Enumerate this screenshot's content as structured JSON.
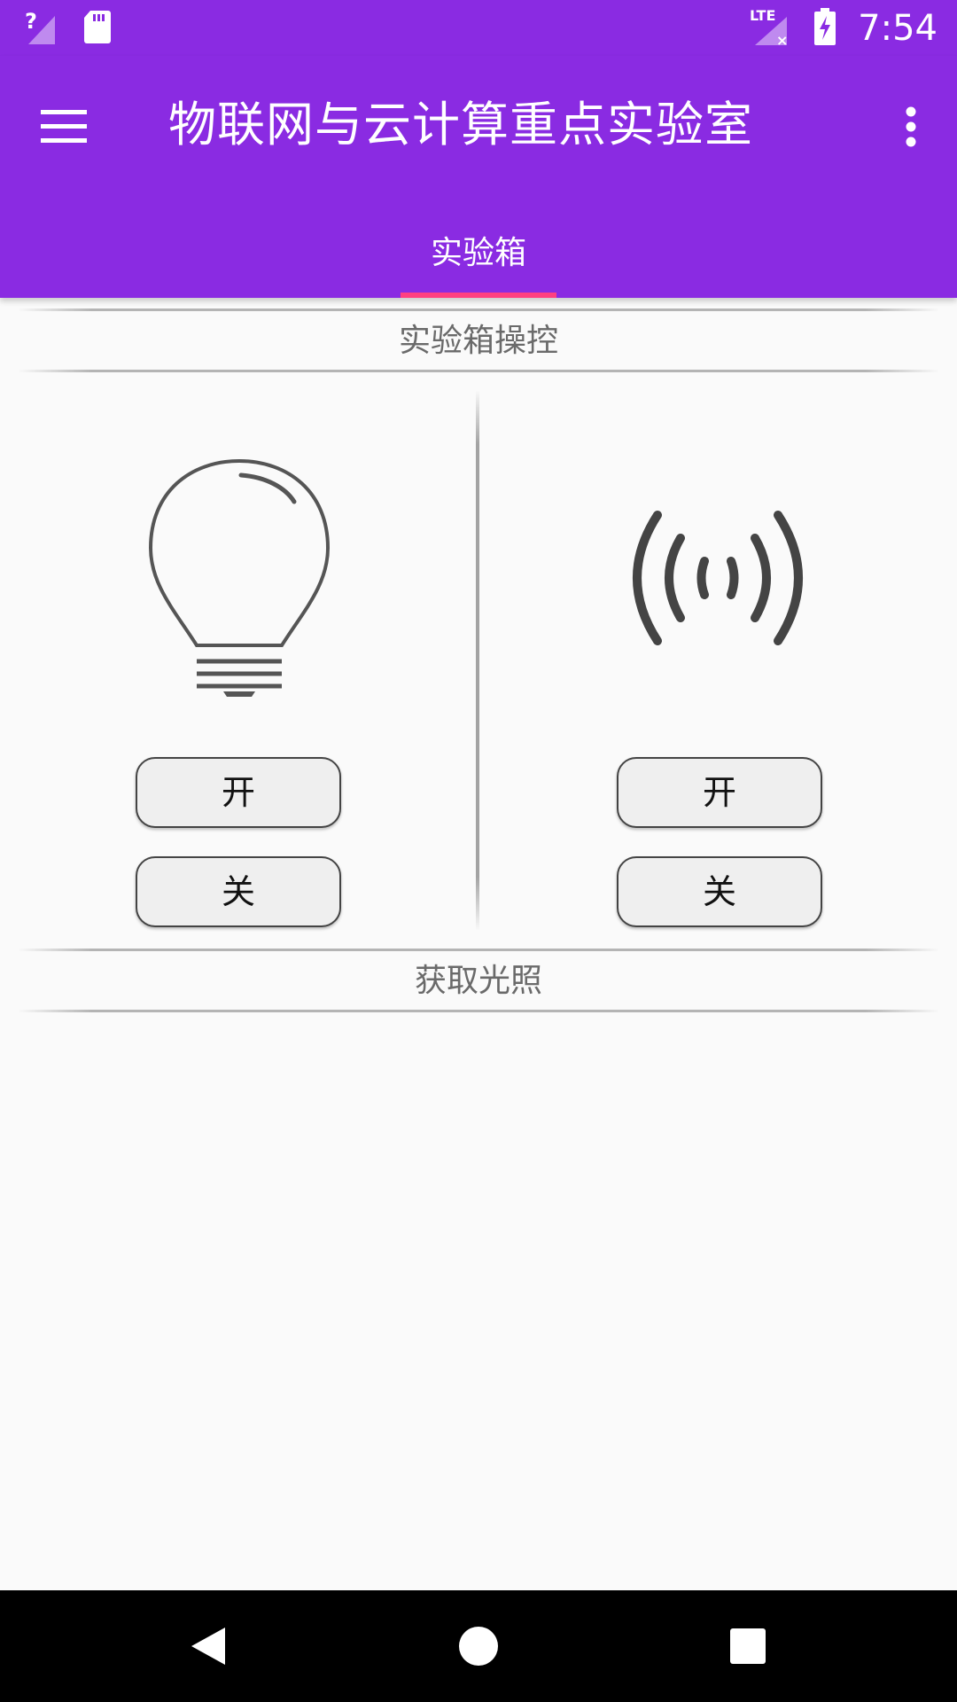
{
  "status_bar": {
    "time": "7:54",
    "icons": [
      "signal-unknown-icon",
      "sd-card-icon",
      "lte-no-signal-icon",
      "battery-charging-icon"
    ],
    "lte_label": "LTE"
  },
  "app_bar": {
    "title": "物联网与云计算重点实验室",
    "menu_icon": "hamburger-menu-icon",
    "overflow_icon": "more-vert-icon",
    "background_color": "#8a2be2",
    "tabs": [
      {
        "label": "实验箱",
        "selected": true
      }
    ],
    "indicator_color": "#ff4081"
  },
  "control_section": {
    "header": "实验箱操控",
    "devices": [
      {
        "icon": "light-bulb-icon",
        "on_label": "开",
        "off_label": "关"
      },
      {
        "icon": "wireless-signal-icon",
        "on_label": "开",
        "off_label": "关"
      }
    ]
  },
  "light_section": {
    "header": "获取光照"
  },
  "nav_bar": {
    "icons": [
      "back-icon",
      "home-icon",
      "recents-icon"
    ]
  }
}
